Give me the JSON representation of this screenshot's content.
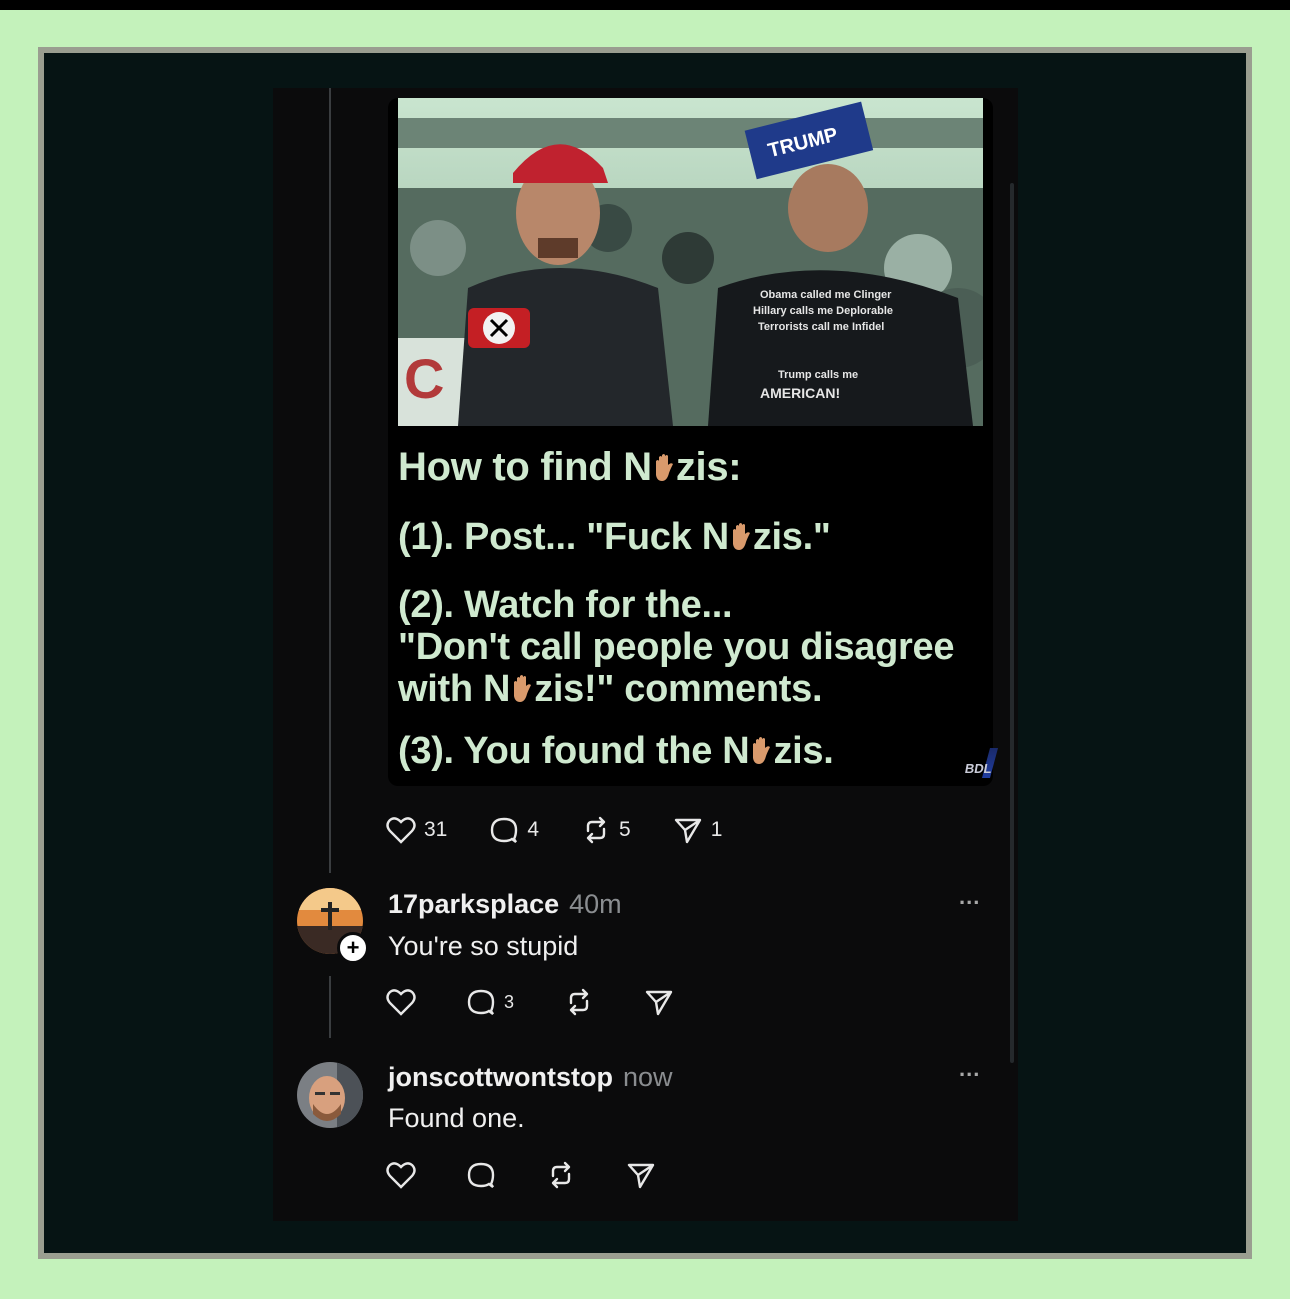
{
  "post": {
    "meme": {
      "photo_sign": "TRUMP",
      "shirt_lines": [
        "Obama called me Clinger",
        "Hillary calls me Deplorable",
        "Terrorists call me Infidel",
        "Trump calls me",
        "AMERICAN!"
      ],
      "headline": [
        "How to find N",
        "zis:"
      ],
      "line1": [
        "(1).  Post... \"Fuck N",
        "zis.\""
      ],
      "line2a": "(2).  Watch for the...",
      "line2b": "\"Don't call people you disagree",
      "line2c": [
        "with N",
        "zis!\" comments."
      ],
      "line3": [
        "(3).  You found the N",
        "zis."
      ],
      "watermark": "BDL"
    },
    "stats": {
      "likes": "31",
      "comments": "4",
      "reposts": "5",
      "shares": "1"
    }
  },
  "replies": [
    {
      "username": "17parksplace",
      "time": "40m",
      "text": "You're so stupid",
      "follow_badge": "+",
      "more": "...",
      "stats": {
        "comments": "3"
      }
    },
    {
      "username": "jonscottwontstop",
      "time": "now",
      "text": "Found one.",
      "more": "..."
    }
  ],
  "icons": {
    "like": "heart-icon",
    "comment": "comment-icon",
    "repost": "repost-icon",
    "share": "share-icon"
  },
  "colors": {
    "page_bg": "#c4f2bb",
    "card_bg": "#0b0b0c",
    "meme_text": "#cfe9cf"
  }
}
